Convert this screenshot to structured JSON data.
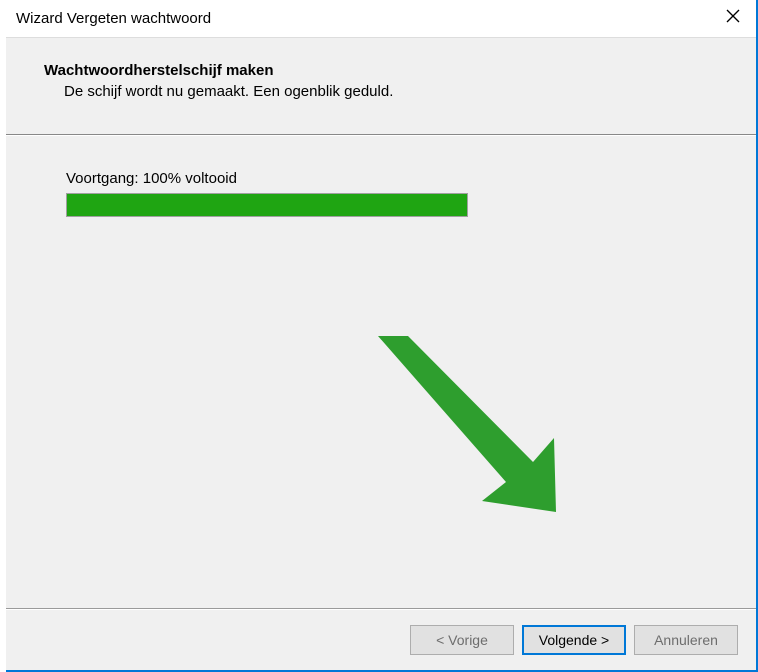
{
  "window": {
    "title": "Wizard Vergeten wachtwoord"
  },
  "header": {
    "title": "Wachtwoordherstelschijf maken",
    "subtitle": "De schijf wordt nu gemaakt. Een ogenblik geduld."
  },
  "progress": {
    "label": "Voortgang: 100% voltooid",
    "percent": 100
  },
  "buttons": {
    "back": "< Vorige",
    "next": "Volgende >",
    "cancel": "Annuleren"
  },
  "colors": {
    "accent": "#0078d7",
    "progress_fill": "#1fa512",
    "arrow": "#2e9e2e"
  }
}
